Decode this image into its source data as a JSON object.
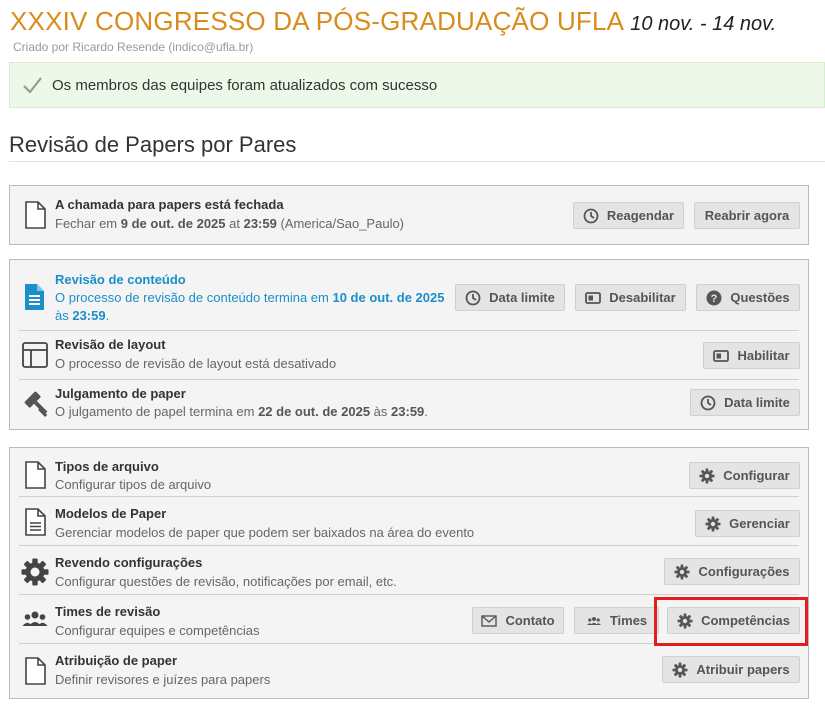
{
  "header": {
    "title": "XXXIV CONGRESSO DA PÓS-GRADUAÇÃO UFLA",
    "dates": "10 nov. - 14 nov.",
    "creator": "Criado por Ricardo Resende (indico@ufla.br)"
  },
  "alert": {
    "message": "Os membros das equipes foram atualizados com sucesso",
    "icon": "check-icon",
    "color": "#eef8e8"
  },
  "section_title": "Revisão de Papers por Pares",
  "call": {
    "title": "A chamada para papers está fechada",
    "desc_prefix": "Fechar em ",
    "desc_date": "9 de out. de 2025",
    "desc_at": " at ",
    "desc_time": "23:59",
    "desc_suffix": " (America/Sao_Paulo)",
    "buttons": {
      "reschedule": "Reagendar",
      "reopen": "Reabrir agora"
    }
  },
  "review": {
    "content": {
      "title": "Revisão de conteúdo",
      "desc_prefix": "O processo de revisão de conteúdo termina em ",
      "desc_date": "10 de out. de 2025",
      "desc_line2_prefix": "às ",
      "desc_time": "23:59",
      "desc_suffix": ".",
      "buttons": {
        "deadline": "Data limite",
        "disable": "Desabilitar",
        "questions": "Questões"
      },
      "color": "#1a8fc9"
    },
    "layout": {
      "title": "Revisão de layout",
      "desc": "O processo de revisão de layout está desativado",
      "buttons": {
        "enable": "Habilitar"
      }
    },
    "judgment": {
      "title": "Julgamento de paper",
      "desc_prefix": "O julgamento de papel termina em ",
      "desc_date": "22 de out. de 2025",
      "desc_mid": " às ",
      "desc_time": "23:59",
      "desc_suffix": ".",
      "buttons": {
        "deadline": "Data limite"
      }
    }
  },
  "settings": {
    "file_types": {
      "title": "Tipos de arquivo",
      "desc": "Configurar tipos de arquivo",
      "button": "Configurar"
    },
    "templates": {
      "title": "Modelos de Paper",
      "desc": "Gerenciar modelos de paper que podem ser baixados na área do evento",
      "button": "Gerenciar"
    },
    "review_config": {
      "title": "Revendo configurações",
      "desc": "Configurar questões de revisão, notificações por email, etc.",
      "button": "Configurações"
    },
    "teams": {
      "title": "Times de revisão",
      "desc": "Configurar equipes e competências",
      "buttons": {
        "contact": "Contato",
        "teams": "Times",
        "competences": "Competências"
      }
    },
    "assignment": {
      "title": "Atribuição de paper",
      "desc": "Definir revisores e juízes para papers",
      "button": "Atribuir papers"
    }
  },
  "colors": {
    "title": "#d98c1b",
    "highlight": "#e0201b",
    "link": "#1a8fc9"
  }
}
